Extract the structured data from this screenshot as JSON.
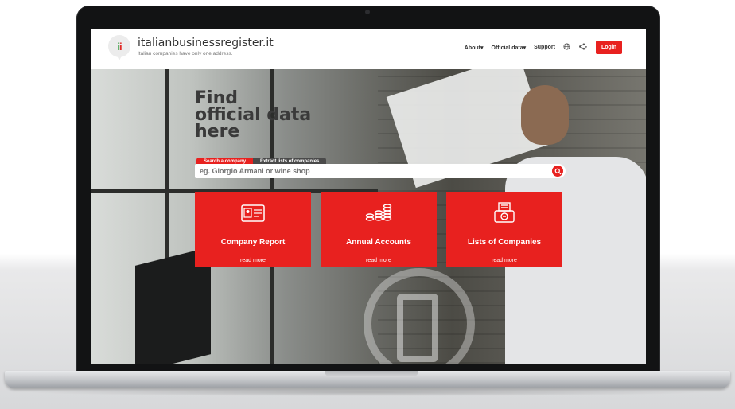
{
  "site": {
    "brand_name": "italianbusinessregister.it",
    "brand_tagline": "Italian companies have only one address.",
    "logo_text": "ii"
  },
  "nav": {
    "about": "About",
    "official_data": "Official data",
    "support": "Support",
    "globe_icon": "globe-icon",
    "share_icon": "share-icon",
    "login": "Login"
  },
  "hero": {
    "title": "Find\nofficial data\nhere"
  },
  "search": {
    "tab_active": "Search a company",
    "tab_inactive": "Extract lists of companies",
    "placeholder": "eg. Giorgio Armani or wine shop"
  },
  "cards": [
    {
      "title": "Company Report",
      "more": "read more",
      "icon": "id-card-icon"
    },
    {
      "title": "Annual Accounts",
      "more": "read more",
      "icon": "coins-icon"
    },
    {
      "title": "Lists of Companies",
      "more": "read more",
      "icon": "printer-list-icon"
    }
  ],
  "colors": {
    "accent": "#e8211f",
    "text_dark": "#333333"
  }
}
